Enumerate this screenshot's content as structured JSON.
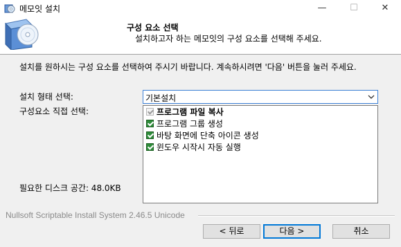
{
  "window": {
    "title": "메모잇 설치",
    "icon": "installer-disc-icon",
    "min_glyph": "—",
    "max_glyph": "☐",
    "close_glyph": "✕"
  },
  "header": {
    "title": "구성 요소 선택",
    "subtitle": "설치하고자 하는 메모잇의 구성 요소를 선택해 주세요."
  },
  "body": {
    "instruction": "설치를 원하시는 구성 요소를 선택하여 주시기 바랍니다. 계속하시려면 '다음' 버튼을 눌러 주세요.",
    "install_type_label": "설치 형태 선택:",
    "install_type_value": "기본설치",
    "direct_select_label": "구성요소 직접 선택:",
    "disk_space_label": "필요한 디스크 공간: 48.0KB"
  },
  "components": [
    {
      "label": "프로그램 파일 복사",
      "checked": true,
      "disabled": true,
      "bold": true
    },
    {
      "label": "프로그램 그룹 생성",
      "checked": true,
      "disabled": false,
      "bold": false
    },
    {
      "label": "바탕 화면에 단축 아이콘 생성",
      "checked": true,
      "disabled": false,
      "bold": false
    },
    {
      "label": "윈도우 시작시 자동 실행",
      "checked": true,
      "disabled": false,
      "bold": false
    }
  ],
  "footer": {
    "brand": "Nullsoft Scriptable Install System 2.46.5 Unicode",
    "back_label": "< 뒤로",
    "next_label": "다음 >",
    "cancel_label": "취소"
  },
  "colors": {
    "focus_accent": "#0078d7",
    "checkbox_checked": "#2e8b3a"
  }
}
